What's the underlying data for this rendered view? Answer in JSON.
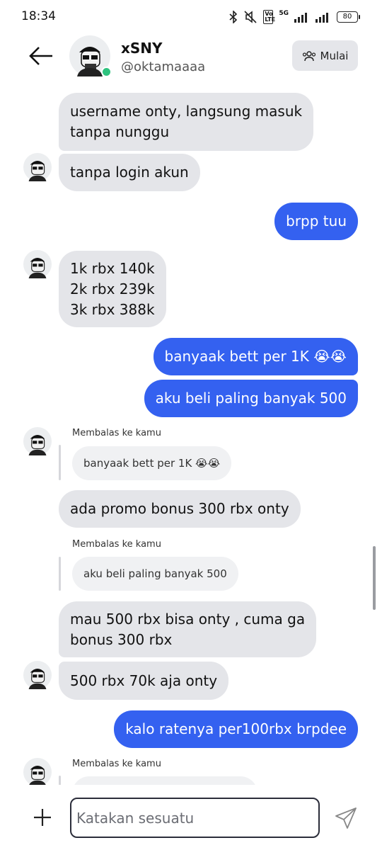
{
  "status_bar": {
    "time": "18:34",
    "volte": "Vo LTE",
    "network": "5G",
    "battery": "80",
    "icons": [
      "bluetooth-icon",
      "mute-icon",
      "signal-icon",
      "signal-icon",
      "battery-icon"
    ]
  },
  "header": {
    "name": "xSNY",
    "handle": "@oktamaaaa",
    "action_label": "Mulai",
    "online": true
  },
  "messages": [
    {
      "direction": "in",
      "lines": [
        "username onty, langsung masuk",
        "tanpa nunggu"
      ]
    },
    {
      "direction": "in",
      "lines": [
        "tanpa login akun"
      ]
    },
    {
      "direction": "out",
      "lines": [
        "brpp tuu"
      ]
    },
    {
      "direction": "in",
      "lines": [
        "1k rbx 140k",
        "2k rbx 239k",
        "3k rbx 388k"
      ]
    },
    {
      "direction": "out",
      "lines": [
        "banyaak bett per 1K 😭😭"
      ]
    },
    {
      "direction": "out",
      "lines": [
        "aku beli paling banyak 500"
      ]
    },
    {
      "direction": "in",
      "reply_label": "Membalas ke kamu",
      "reply_to": "banyaak bett per 1K 😭😭",
      "lines": [
        "ada promo bonus 300 rbx onty"
      ]
    },
    {
      "direction": "in",
      "reply_label": "Membalas ke kamu",
      "reply_to": "aku beli paling banyak 500",
      "lines": [
        "mau 500 rbx bisa onty , cuma ga",
        "bonus 300 rbx"
      ]
    },
    {
      "direction": "in",
      "lines": [
        "500 rbx 70k aja onty"
      ]
    },
    {
      "direction": "out",
      "lines": [
        "kalo ratenya per100rbx brpdee"
      ]
    },
    {
      "direction": "in",
      "reply_label": "Membalas ke kamu"
    }
  ],
  "composer": {
    "placeholder": "Katakan sesuatu"
  },
  "colors": {
    "outgoing_bubble": "#3461f0",
    "incoming_bubble": "#e4e5e9",
    "online_dot": "#2ec27e"
  }
}
